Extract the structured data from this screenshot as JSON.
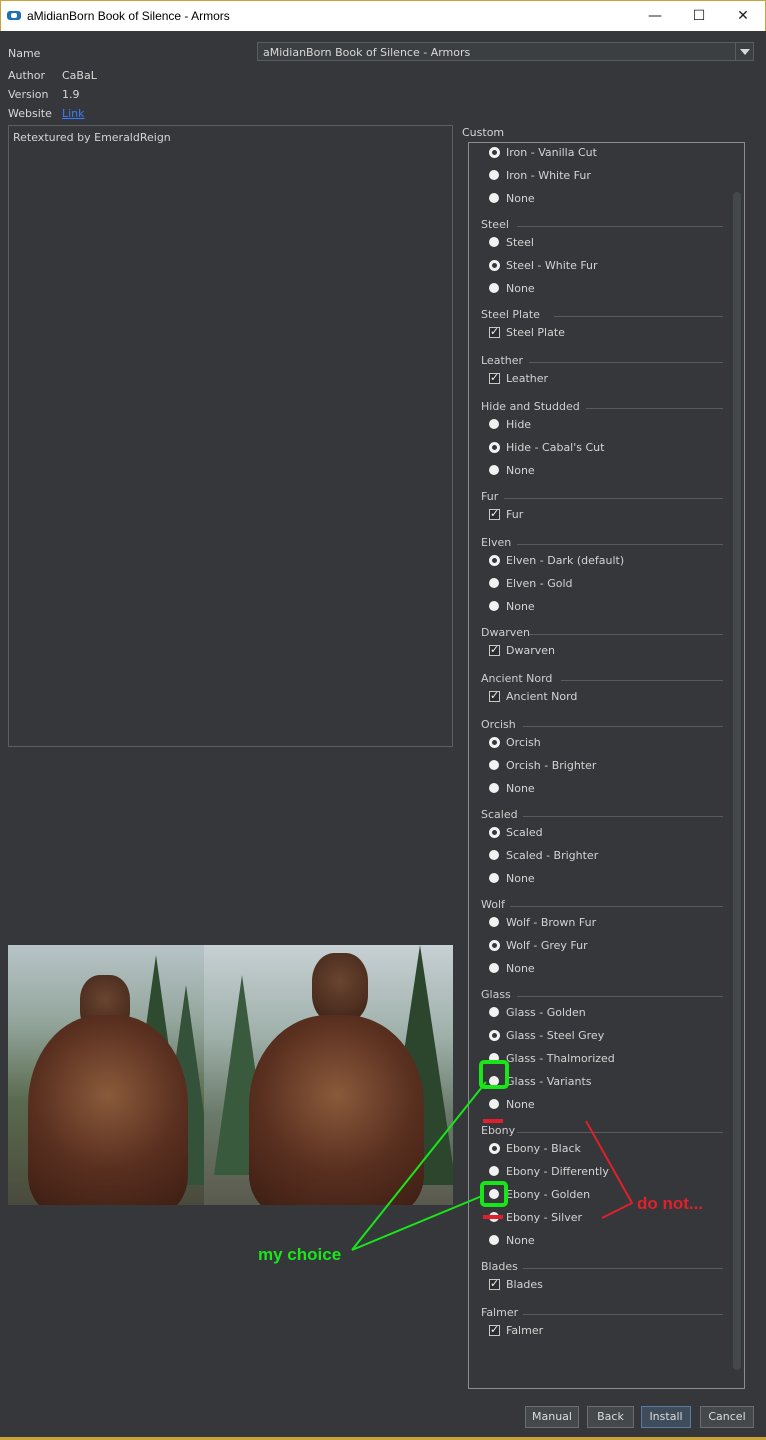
{
  "window": {
    "title": "aMidianBorn Book of Silence - Armors"
  },
  "info": {
    "name_label": "Name",
    "name_value": "aMidianBorn Book of Silence - Armors",
    "author_label": "Author",
    "author_value": "CaBaL",
    "version_label": "Version",
    "version_value": "1.9",
    "website_label": "Website",
    "website_link": "Link"
  },
  "description": "Retextured by EmeraldReign",
  "custom_label": "Custom",
  "groups": [
    {
      "title": "",
      "options": [
        {
          "label": "Iron - Vanilla Cut",
          "type": "radio",
          "selected": true
        },
        {
          "label": "Iron - White Fur",
          "type": "radio",
          "selected": false
        },
        {
          "label": "None",
          "type": "radio",
          "selected": false
        }
      ]
    },
    {
      "title": "Steel",
      "options": [
        {
          "label": "Steel",
          "type": "radio",
          "selected": false
        },
        {
          "label": "Steel - White Fur",
          "type": "radio",
          "selected": true
        },
        {
          "label": "None",
          "type": "radio",
          "selected": false
        }
      ]
    },
    {
      "title": "Steel Plate",
      "options": [
        {
          "label": "Steel Plate",
          "type": "check",
          "selected": true
        }
      ]
    },
    {
      "title": "Leather",
      "options": [
        {
          "label": "Leather",
          "type": "check",
          "selected": true
        }
      ]
    },
    {
      "title": "Hide and Studded",
      "options": [
        {
          "label": "Hide",
          "type": "radio",
          "selected": false
        },
        {
          "label": "Hide - Cabal's Cut",
          "type": "radio",
          "selected": true
        },
        {
          "label": "None",
          "type": "radio",
          "selected": false
        }
      ]
    },
    {
      "title": "Fur",
      "options": [
        {
          "label": "Fur",
          "type": "check",
          "selected": true
        }
      ]
    },
    {
      "title": "Elven",
      "options": [
        {
          "label": "Elven - Dark (default)",
          "type": "radio",
          "selected": true
        },
        {
          "label": "Elven - Gold",
          "type": "radio",
          "selected": false
        },
        {
          "label": "None",
          "type": "radio",
          "selected": false
        }
      ]
    },
    {
      "title": "Dwarven",
      "options": [
        {
          "label": "Dwarven",
          "type": "check",
          "selected": true
        }
      ]
    },
    {
      "title": "Ancient Nord",
      "options": [
        {
          "label": "Ancient Nord",
          "type": "check",
          "selected": true
        }
      ]
    },
    {
      "title": "Orcish",
      "options": [
        {
          "label": "Orcish",
          "type": "radio",
          "selected": true
        },
        {
          "label": "Orcish - Brighter",
          "type": "radio",
          "selected": false
        },
        {
          "label": "None",
          "type": "radio",
          "selected": false
        }
      ]
    },
    {
      "title": "Scaled",
      "options": [
        {
          "label": "Scaled",
          "type": "radio",
          "selected": true
        },
        {
          "label": "Scaled - Brighter",
          "type": "radio",
          "selected": false
        },
        {
          "label": "None",
          "type": "radio",
          "selected": false
        }
      ]
    },
    {
      "title": "Wolf",
      "options": [
        {
          "label": "Wolf - Brown Fur",
          "type": "radio",
          "selected": false
        },
        {
          "label": "Wolf - Grey Fur",
          "type": "radio",
          "selected": true
        },
        {
          "label": "None",
          "type": "radio",
          "selected": false
        }
      ]
    },
    {
      "title": "Glass",
      "options": [
        {
          "label": "Glass - Golden",
          "type": "radio",
          "selected": false
        },
        {
          "label": "Glass - Steel Grey",
          "type": "radio",
          "selected": true
        },
        {
          "label": "Glass - Thalmorized",
          "type": "radio",
          "selected": false
        },
        {
          "label": "Glass - Variants",
          "type": "radio",
          "selected": false
        },
        {
          "label": "None",
          "type": "radio",
          "selected": false
        }
      ]
    },
    {
      "title": "Ebony",
      "options": [
        {
          "label": "Ebony - Black",
          "type": "radio",
          "selected": true
        },
        {
          "label": "Ebony - Differently",
          "type": "radio",
          "selected": false
        },
        {
          "label": "Ebony - Golden",
          "type": "radio",
          "selected": false
        },
        {
          "label": "Ebony - Silver",
          "type": "radio",
          "selected": false
        },
        {
          "label": "None",
          "type": "radio",
          "selected": false
        }
      ]
    },
    {
      "title": "Blades",
      "options": [
        {
          "label": "Blades",
          "type": "check",
          "selected": true
        }
      ]
    },
    {
      "title": "Falmer",
      "options": [
        {
          "label": "Falmer",
          "type": "check",
          "selected": true
        }
      ]
    }
  ],
  "buttons": {
    "manual": "Manual",
    "back": "Back",
    "install": "Install",
    "cancel": "Cancel"
  },
  "annotations": {
    "my_choice": "my choice",
    "do_not": "do not...",
    "green": "#19e619",
    "red": "#e0202a"
  }
}
